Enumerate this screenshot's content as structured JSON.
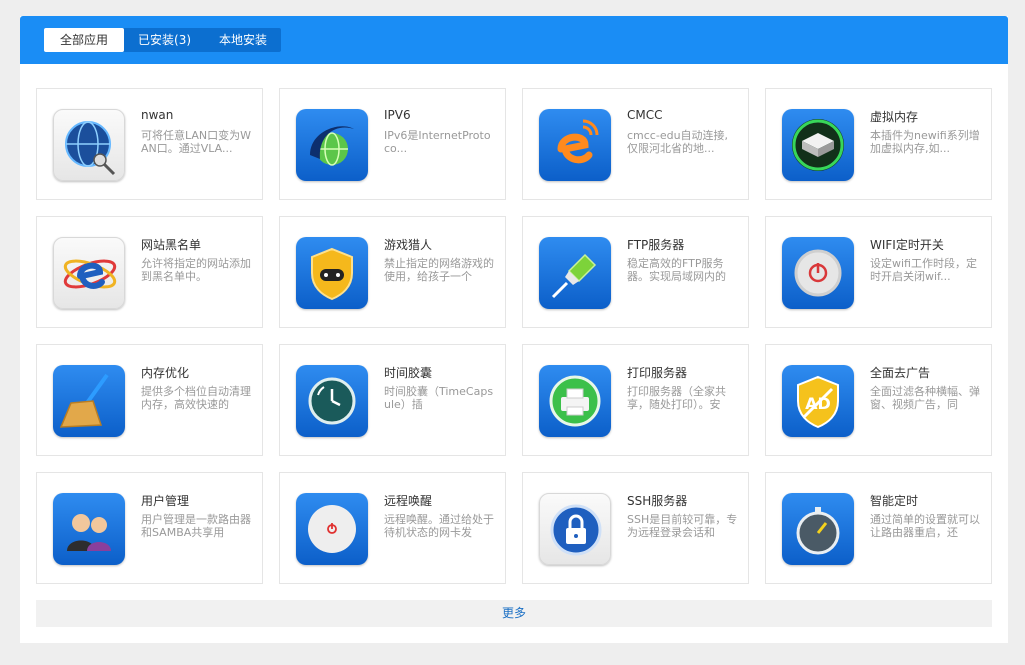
{
  "tabs": [
    {
      "label": "全部应用",
      "active": true
    },
    {
      "label": "已安装(3)",
      "active": false
    },
    {
      "label": "本地安装",
      "active": false
    }
  ],
  "apps": [
    {
      "name": "nwan",
      "desc": "可将任意LAN口变为WAN口。通过VLA...",
      "icon": "network-globe-icon"
    },
    {
      "name": "IPV6",
      "desc": "IPv6是InternetProtoco...",
      "icon": "ipv6-globe-icon"
    },
    {
      "name": "CMCC",
      "desc": "cmcc-edu自动连接,仅限河北省的地...",
      "icon": "cmcc-e-icon"
    },
    {
      "name": "虚拟内存",
      "desc": "本插件为newifi系列增加虚拟内存,如...",
      "icon": "hard-drive-icon"
    },
    {
      "name": "网站黑名单",
      "desc": "允许将指定的网站添加到黑名单中。",
      "icon": "browser-e-icon"
    },
    {
      "name": "游戏猎人",
      "desc": "禁止指定的网络游戏的使用，给孩子一个",
      "icon": "game-shield-icon"
    },
    {
      "name": "FTP服务器",
      "desc": "稳定高效的FTP服务器。实现局域网内的",
      "icon": "ftp-plug-icon"
    },
    {
      "name": "WIFI定时开关",
      "desc": "设定wifi工作时段，定时开启关闭wif...",
      "icon": "power-button-icon"
    },
    {
      "name": "内存优化",
      "desc": "提供多个档位自动清理内存，高效快速的",
      "icon": "broom-icon"
    },
    {
      "name": "时间胶囊",
      "desc": "时间胶囊（TimeCapsule）插",
      "icon": "time-capsule-icon"
    },
    {
      "name": "打印服务器",
      "desc": "打印服务器（全家共享，随处打印）。安",
      "icon": "printer-icon"
    },
    {
      "name": "全面去广告",
      "desc": "全面过滤各种横幅、弹窗、视频广告，同",
      "icon": "ad-block-shield-icon"
    },
    {
      "name": "用户管理",
      "desc": "用户管理是一款路由器和SAMBA共享用",
      "icon": "users-icon"
    },
    {
      "name": "远程唤醒",
      "desc": "远程唤醒。通过给处于待机状态的网卡发",
      "icon": "wake-power-icon"
    },
    {
      "name": "SSH服务器",
      "desc": "SSH是目前较可靠，专为远程登录会话和",
      "icon": "padlock-icon"
    },
    {
      "name": "智能定时",
      "desc": "通过简单的设置就可以让路由器重启，还",
      "icon": "stopwatch-icon"
    }
  ],
  "more_label": "更多",
  "colors": {
    "topbar": "#1a8df5",
    "icon_blue": "#1a6fe0",
    "link": "#1a6fc4"
  }
}
